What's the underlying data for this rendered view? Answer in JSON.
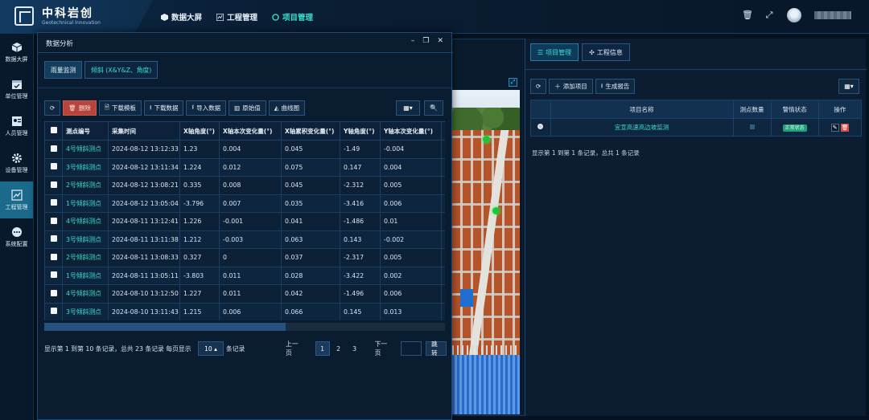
{
  "brand": {
    "title": "中科岩创",
    "subtitle": "Geotechnical Innovation"
  },
  "nav": [
    {
      "label": "数据大屏",
      "icon": "cube-icon"
    },
    {
      "label": "工程管理",
      "icon": "chart-icon"
    },
    {
      "label": "项目管理",
      "icon": "circle-icon",
      "active": true
    }
  ],
  "sidebar": [
    {
      "label": "数据大屏",
      "icon": "cube-icon"
    },
    {
      "label": "单位管理",
      "icon": "calendar-icon"
    },
    {
      "label": "人员管理",
      "icon": "person-card-icon"
    },
    {
      "label": "设备管理",
      "icon": "gear-icon"
    },
    {
      "label": "工程管理",
      "icon": "chart-icon",
      "active": true
    },
    {
      "label": "系统配置",
      "icon": "dots-icon"
    }
  ],
  "right_panel": {
    "tabs": [
      {
        "label": "项目管理",
        "active": true
      },
      {
        "label": "工程信息"
      }
    ],
    "toolbar": {
      "add": "添加项目",
      "report": "生成报告"
    },
    "columns": [
      "项目名称",
      "测点数量",
      "警情状态",
      "操作"
    ],
    "row": {
      "name": "宜宣高速高边坡监测",
      "status": "正常状态"
    },
    "info": "显示第 1 到第 1 条记录，总共 1 条记录"
  },
  "modal": {
    "title": "数据分析",
    "tabs": [
      {
        "label": "雨量监测",
        "active": true
      },
      {
        "label": "倾斜 (X&Y&Z、角度)"
      }
    ],
    "toolbar": {
      "delete": "删除",
      "download_template": "下载模板",
      "download_data": "下载数据",
      "import_data": "导入数据",
      "raw_value": "原始值",
      "curve_chart": "曲线图"
    },
    "columns": [
      "测点编号",
      "采集时间",
      "X轴角度(°)",
      "X轴本次变化量(°)",
      "X轴累积变化量(°)",
      "Y轴角度(°)",
      "Y轴本次变化量(°)",
      "Y"
    ],
    "rows": [
      [
        "4号倾斜测点",
        "2024-08-12 13:12:33",
        "1.23",
        "0.004",
        "0.045",
        "-1.49",
        "-0.004",
        ""
      ],
      [
        "3号倾斜测点",
        "2024-08-12 13:11:34",
        "1.224",
        "0.012",
        "0.075",
        "0.147",
        "0.004",
        ""
      ],
      [
        "2号倾斜测点",
        "2024-08-12 13:08:21",
        "0.335",
        "0.008",
        "0.045",
        "-2.312",
        "0.005",
        ""
      ],
      [
        "1号倾斜测点",
        "2024-08-12 13:05:04",
        "-3.796",
        "0.007",
        "0.035",
        "-3.416",
        "0.006",
        ""
      ],
      [
        "4号倾斜测点",
        "2024-08-11 13:12:41",
        "1.226",
        "-0.001",
        "0.041",
        "-1.486",
        "0.01",
        ""
      ],
      [
        "3号倾斜测点",
        "2024-08-11 13:11:38",
        "1.212",
        "-0.003",
        "0.063",
        "0.143",
        "-0.002",
        ""
      ],
      [
        "2号倾斜测点",
        "2024-08-11 13:08:33",
        "0.327",
        "0",
        "0.037",
        "-2.317",
        "0.005",
        ""
      ],
      [
        "1号倾斜测点",
        "2024-08-11 13:05:11",
        "-3.803",
        "0.011",
        "0.028",
        "-3.422",
        "0.002",
        ""
      ],
      [
        "4号倾斜测点",
        "2024-08-10 13:12:50",
        "1.227",
        "0.011",
        "0.042",
        "-1.496",
        "0.006",
        ""
      ],
      [
        "3号倾斜测点",
        "2024-08-10 13:11:43",
        "1.215",
        "0.006",
        "0.066",
        "0.145",
        "0.013",
        ""
      ]
    ],
    "footer": {
      "info": "显示第 1 到第 10 条记录，总共 23 条记录 每页显示",
      "page_size": "10",
      "per_page_suffix": "条记录",
      "prev": "上一页",
      "pages": [
        "1",
        "2",
        "3"
      ],
      "current_page": "1",
      "next": "下一页",
      "go": "跳转"
    }
  },
  "colors": {
    "accent": "#36e0cf",
    "danger": "#b7453d",
    "status_ok": "#1f9e78"
  }
}
